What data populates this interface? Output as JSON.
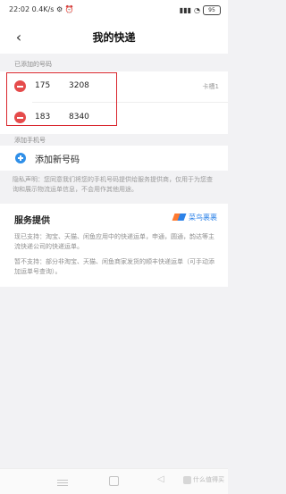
{
  "status_bar": {
    "time": "22:02",
    "speed": "0.4K/s",
    "icons": [
      "settings-icon",
      "alarm-icon",
      "signal-icon",
      "wifi-icon"
    ],
    "battery": "95"
  },
  "nav": {
    "back_icon": "chevron-left-icon",
    "title": "我的快递"
  },
  "added_section": {
    "label": "已添加的号码",
    "numbers": [
      {
        "prefix": "175",
        "suffix": "3208",
        "tag": "卡槽1"
      },
      {
        "prefix": "183",
        "suffix": "8340",
        "tag": ""
      }
    ]
  },
  "add_section": {
    "label": "添加手机号",
    "add_label": "添加新号码"
  },
  "privacy_note": "隐私声明：您同意我们将您的手机号码提供给服务提供商，仅用于为您查询和展示物流运单信息，不会用作其他用途。",
  "service": {
    "title": "服务提供",
    "brand_name": "菜鸟裹裹",
    "supported": "现已支持：淘宝、天猫、闲鱼应用中的快递运单，申通，圆通，韵达等主流快递公司的快递运单。",
    "unsupported": "暂不支持：部分非淘宝、天猫、闲鱼商家发货的顺丰快递运单（可手动添加运单号查询）。"
  },
  "colors": {
    "accent_red": "#d9272e",
    "minus_red": "#e54b4b",
    "plus_blue": "#2f8fe8",
    "brand_blue": "#2c82e8"
  },
  "watermark": "什么值得买"
}
